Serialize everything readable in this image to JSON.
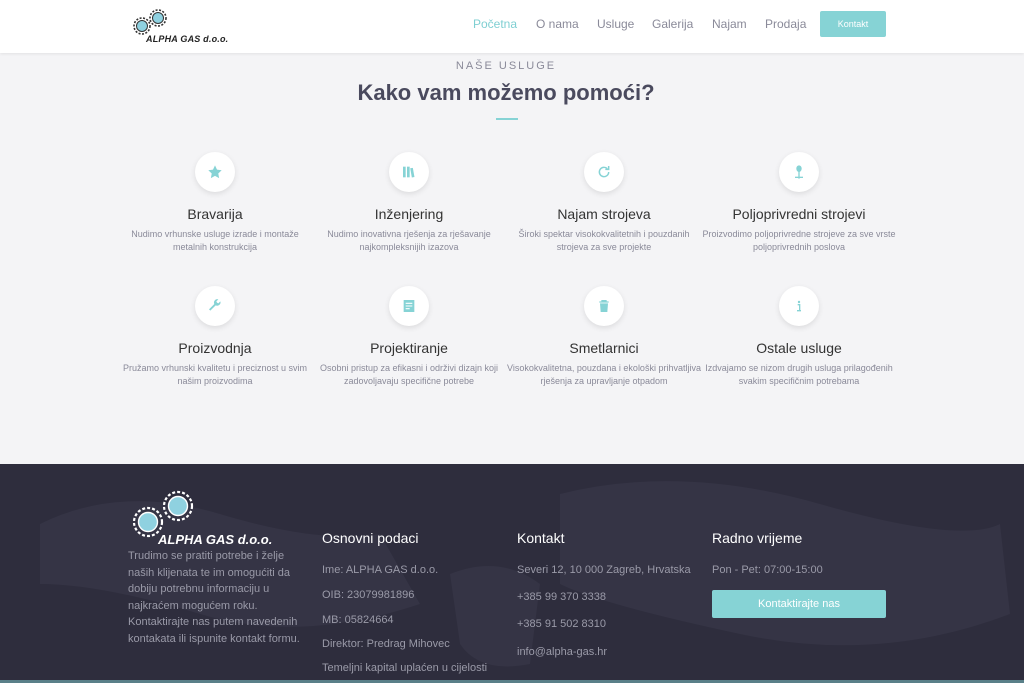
{
  "brand": {
    "name": "ALPHA GAS d.o.o."
  },
  "nav": {
    "items": [
      "Početna",
      "O nama",
      "Usluge",
      "Galerija",
      "Najam",
      "Prodaja"
    ],
    "cta": "Kontakt"
  },
  "services_section": {
    "eyebrow": "NAŠE USLUGE",
    "title": "Kako vam možemo pomoći?",
    "items": [
      {
        "title": "Bravarija",
        "desc": "Nudimo vrhunske usluge izrade i montaže metalnih konstrukcija",
        "icon": "star-icon"
      },
      {
        "title": "Inženjering",
        "desc": "Nudimo inovativna rješenja za rješavanje najkompleksnijih izazova",
        "icon": "books-icon"
      },
      {
        "title": "Najam strojeva",
        "desc": "Široki spektar visokokvalitetnih i pouzdanih strojeva za sve projekte",
        "icon": "refresh-icon"
      },
      {
        "title": "Poljoprivredni strojevi",
        "desc": "Proizvodimo poljoprivredne strojeve za sve vrste poljoprivrednih poslova",
        "icon": "sprout-icon"
      },
      {
        "title": "Proizvodnja",
        "desc": "Pružamo vrhunski kvalitetu i preciznost u svim našim proizvodima",
        "icon": "wrench-icon"
      },
      {
        "title": "Projektiranje",
        "desc": "Osobni pristup za efikasni i održivi dizajn koji zadovoljavaju specifične potrebe",
        "icon": "document-icon"
      },
      {
        "title": "Smetlarnici",
        "desc": "Visokokvalitetna, pouzdana i ekološki prihvatljiva rješenja za upravljanje otpadom",
        "icon": "trash-icon"
      },
      {
        "title": "Ostale usluge",
        "desc": "Izdvajamo se nizom drugih usluga prilagođenih svakim specifičnim potrebama",
        "icon": "info-icon"
      }
    ]
  },
  "footer": {
    "about": "Trudimo se pratiti potrebe i želje naših klijenata te im omogućiti da dobiju potrebnu informaciju u najkraćem mogućem roku. Kontaktirajte nas putem navedenih kontakata ili ispunite kontakt formu.",
    "basic": {
      "heading": "Osnovni podaci",
      "items": [
        "Ime: ALPHA GAS d.o.o.",
        "OIB: 23079981896",
        "MB: 05824664",
        "Direktor: Predrag Mihovec",
        "Temeljni kapital uplaćen u cijelosti"
      ]
    },
    "contact": {
      "heading": "Kontakt",
      "items": [
        "Severi 12, 10 000 Zagreb, Hrvatska",
        "+385 99 370 3338",
        "+385 91 502 8310",
        "info@alpha-gas.hr"
      ]
    },
    "hours": {
      "heading": "Radno vrijeme",
      "text": "Pon - Pet: 07:00-15:00",
      "button": "Kontaktirajte nas"
    }
  },
  "colors": {
    "accent": "#86d3d5",
    "footer_bg": "#2e2d3d",
    "text_muted": "#8a8a99"
  }
}
